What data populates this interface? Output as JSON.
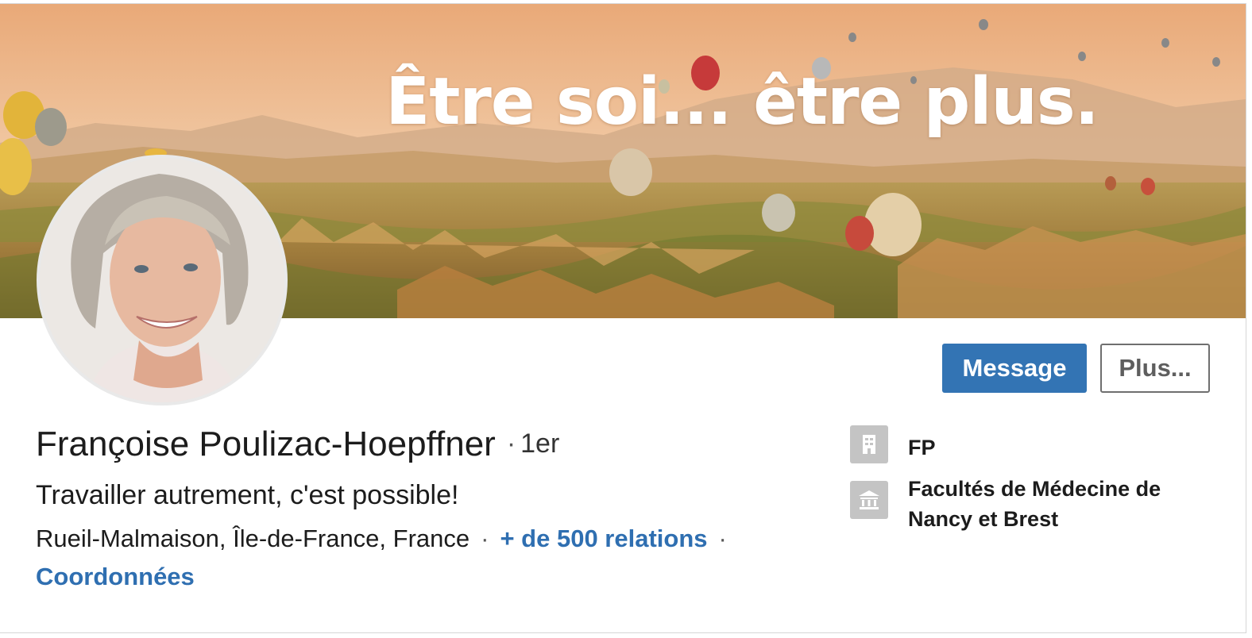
{
  "banner": {
    "tagline": "Être soi... être plus."
  },
  "profile": {
    "name": "Françoise Poulizac-Hoepffner",
    "separator": "·",
    "degree": "1er",
    "headline": "Travailler autrement, c'est possible!",
    "location": "Rueil-Malmaison, Île-de-France, France",
    "connections": "+ de 500 relations",
    "contact_info": "Coordonnées"
  },
  "actions": {
    "message_label": "Message",
    "more_label": "Plus..."
  },
  "sidebar": {
    "items": [
      {
        "icon": "building-icon",
        "label": "FP"
      },
      {
        "icon": "school-icon",
        "label": "Facultés de Médecine de Nancy et Brest"
      }
    ]
  },
  "colors": {
    "primary": "#3374b4",
    "link": "#2f6fb1",
    "icon_bg": "#c4c4c4"
  }
}
